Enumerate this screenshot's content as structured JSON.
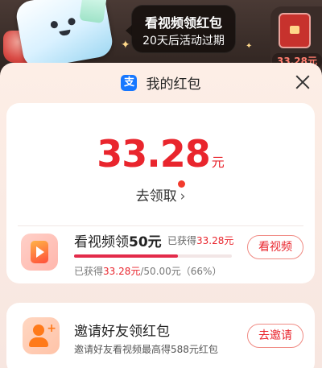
{
  "banner": {
    "bubble_line1": "看视频领红包",
    "bubble_line2": "20天后活动过期",
    "side_amount": "33.28元"
  },
  "sheet": {
    "title": "我的红包",
    "logo_glyph": "支"
  },
  "balance": {
    "amount": "33.28",
    "unit": "元",
    "claim_label": "去领取",
    "claim_chevron": "›"
  },
  "video_task": {
    "title_prefix": "看视频领",
    "title_amount": "50元",
    "earned_prefix": "已获得",
    "earned_value": "33.28元",
    "progress_fraction": 0.66,
    "sub_prefix": "已获得",
    "sub_value": "33.28元",
    "sub_total": "/50.00元（66%）",
    "button": "看视频"
  },
  "invite_task": {
    "title": "邀请好友领红包",
    "subtitle": "邀请好友看视频最高得588元红包",
    "button": "去邀请"
  },
  "colors": {
    "accent_red": "#e9252d",
    "progress": "#e32b4a",
    "alipay_blue": "#1677ff"
  }
}
